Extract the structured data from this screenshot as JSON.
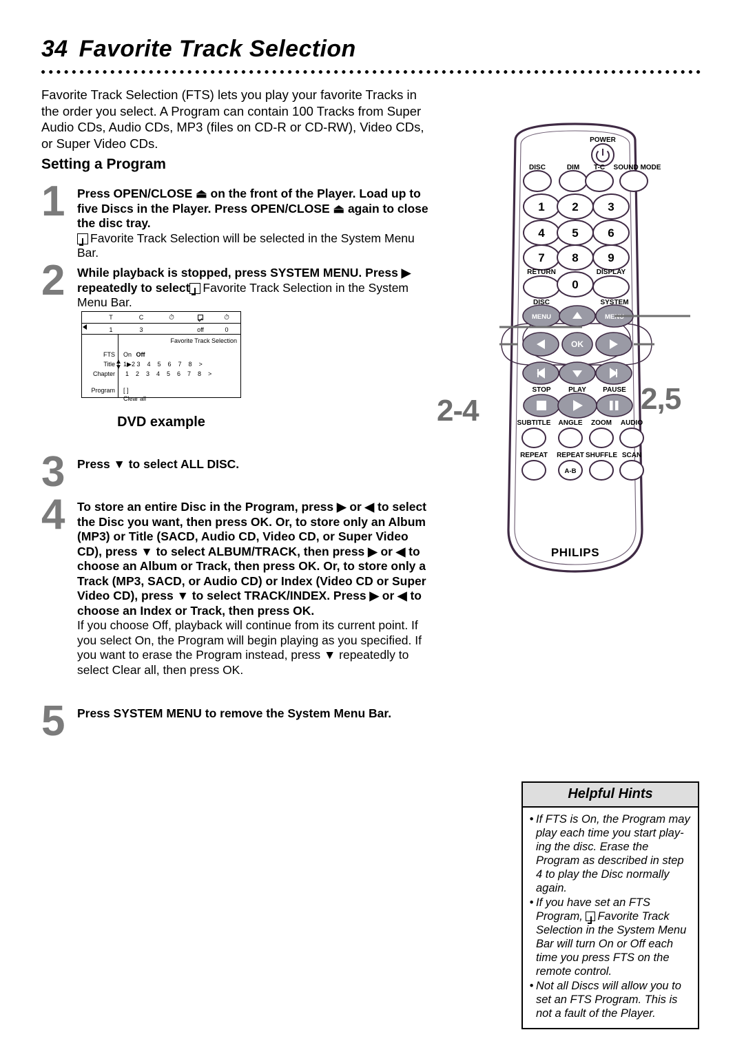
{
  "page": {
    "number": "34",
    "title": "Favorite Track Selection",
    "intro": "Favorite Track Selection (FTS) lets you play your favorite Tracks in the order you select. A Program can contain 100 Tracks from Super Audio CDs, Audio CDs, MP3 (files on CD-R or CD-RW), Video CDs, or Super Video CDs.",
    "section_heading": "Setting a Program"
  },
  "steps": [
    {
      "number": "1",
      "bold_text": "Press OPEN/CLOSE ⏏ on the front of the Player. Load up to five Discs in the Player. Press OPEN/CLOSE ⏏ again to close the disc tray.",
      "note_icon": "fts-checkbox-icon",
      "note_text": "Favorite Track Selection will be selected in the System Menu Bar."
    },
    {
      "number": "2",
      "bold_text_1": "While playback is stopped, press SYSTEM MENU. Press",
      "bold_text_2": "▶ repeatedly to select",
      "note_icon": "fts-checkbox-icon",
      "note_text": "Favorite Track Selection in the System Menu Bar."
    },
    {
      "number": "3",
      "bold_text": "Press ▼ to select ALL DISC."
    },
    {
      "number": "4",
      "bold_text": "To store an entire Disc in the Program, press ▶ or ◀ to select the Disc you want, then press OK. Or, to store only an Album (MP3) or Title (SACD, Audio CD, Video CD, or Super Video CD), press ▼ to select ALBUM/TRACK, then press ▶ or ◀ to choose an Album or Track, then press OK. Or, to store only a Track (MP3, SACD, or Audio CD) or Index (Video CD or Super Video CD), press ▼ to select TRACK/INDEX. Press ▶ or ◀ to choose an Index or Track, then press OK.",
      "regular_text": "If you choose Off, playback will continue from its current point. If you select On, the Program will begin playing as you specified. If you want to erase the Program instead, press ▼ repeatedly to select Clear all, then press OK."
    },
    {
      "number": "5",
      "bold_text": "Press SYSTEM MENU to remove the System Menu Bar."
    }
  ],
  "dvd_example": {
    "caption": "DVD example",
    "menubar": {
      "icons": [
        "T",
        "C",
        "clock-icon",
        "fts-checkbox-icon",
        "timer-icon"
      ],
      "values": [
        "1",
        "3",
        "",
        "off",
        "0"
      ]
    },
    "panel": {
      "title": "Favorite Track Selection",
      "rows": [
        {
          "label": "FTS",
          "values": [
            "On",
            "Off"
          ],
          "selected": "Off"
        },
        {
          "label": "Title",
          "values": [
            "1",
            "2",
            "3",
            "4",
            "5",
            "6",
            "7",
            "8",
            ">"
          ],
          "cursor_after": "1"
        },
        {
          "label": "Chapter",
          "values": [
            "1",
            "2",
            "3",
            "4",
            "5",
            "6",
            "7",
            "8",
            ">"
          ]
        },
        {
          "label": "Program",
          "values": [
            "[ ]",
            "Clear all"
          ]
        }
      ]
    }
  },
  "remote": {
    "brand": "PHILIPS",
    "callouts": {
      "left": "2-4",
      "right": "2,5"
    },
    "power_label": "POWER",
    "row_top": [
      "DISC",
      "DIM",
      "T-C",
      "SOUND MODE"
    ],
    "numpad": [
      "1",
      "2",
      "3",
      "4",
      "5",
      "6",
      "7",
      "8",
      "9",
      "0"
    ],
    "row_return": [
      "RETURN",
      "DISPLAY"
    ],
    "row_menu": [
      "DISC",
      "SYSTEM"
    ],
    "menu_button_label": "MENU",
    "ok_label": "OK",
    "row_transport": [
      "STOP",
      "PLAY",
      "PAUSE"
    ],
    "row_features": [
      "SUBTITLE",
      "ANGLE",
      "ZOOM",
      "AUDIO"
    ],
    "row_modes": [
      "REPEAT",
      "REPEAT",
      "SHUFFLE",
      "SCAN"
    ],
    "repeat_ab_label": "A-B"
  },
  "helpful_hints": {
    "title": "Helpful Hints",
    "bullet": "•",
    "items": [
      "If FTS is On, the Program may play each time you start play-ing the disc. Erase the Program as described in step 4 to play the Disc normally again.",
      "If you have set an FTS Program, ☑ Favorite Track Selection in the System Menu Bar will turn On or Off each time you press FTS on the remote control.",
      "Not all Discs will allow you to set an FTS Program. This is not a fault of the Player."
    ],
    "item2_before": "If you have set an FTS Program,",
    "item2_after": "Favorite Track Selection in the System Menu Bar will turn On or Off each time you press FTS on the remote control."
  },
  "colors": {
    "step_number": "#7b7b7b",
    "remote_outline": "#3f2a44",
    "button_fill": "#9a9aa5",
    "hints_header_bg": "#dedede"
  }
}
